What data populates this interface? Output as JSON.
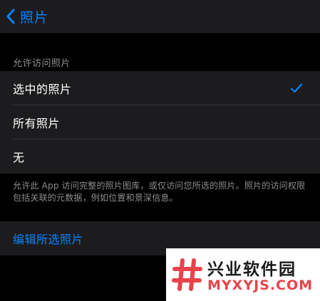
{
  "nav": {
    "back_label": "照片",
    "back_icon": "chevron-left-icon"
  },
  "section": {
    "header": "允许访问照片",
    "options": [
      {
        "label": "选中的照片",
        "selected": true
      },
      {
        "label": "所有照片",
        "selected": false
      },
      {
        "label": "无",
        "selected": false
      }
    ],
    "footer": "允许此 App 访问完整的照片图库，或仅访问您所选的照片。照片的访问权限包括关联的元数据，例如位置和景深信息。"
  },
  "action": {
    "label": "编辑所选照片"
  },
  "watermark": {
    "title": "兴业软件园",
    "subtitle": "MYXYJS.COM"
  },
  "colors": {
    "accent": "#0a84ff",
    "background": "#000000",
    "cell": "#1c1c1e",
    "secondary_text": "#8e8e93",
    "watermark_red": "#e8434b"
  }
}
